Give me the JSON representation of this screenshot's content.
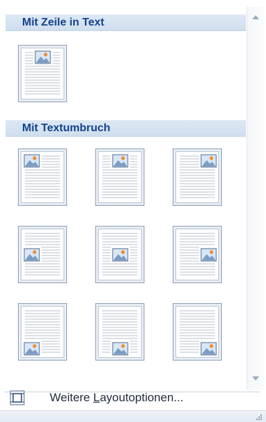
{
  "gallery": {
    "sections": [
      {
        "title": "Mit Zeile in Text"
      },
      {
        "title": "Mit Textumbruch"
      }
    ],
    "inline_options": [
      {
        "name": "inline",
        "image_position": "top-center"
      }
    ],
    "wrap_options": [
      {
        "name": "top-left",
        "image_position": "top-left"
      },
      {
        "name": "top-center",
        "image_position": "top-center"
      },
      {
        "name": "top-right",
        "image_position": "top-right"
      },
      {
        "name": "middle-left",
        "image_position": "middle-left"
      },
      {
        "name": "middle-center",
        "image_position": "middle-center"
      },
      {
        "name": "middle-right",
        "image_position": "middle-right"
      },
      {
        "name": "bottom-left",
        "image_position": "bottom-left"
      },
      {
        "name": "bottom-center",
        "image_position": "bottom-center"
      },
      {
        "name": "bottom-right",
        "image_position": "bottom-right"
      }
    ]
  },
  "more_options": {
    "label_before": "Weitere ",
    "label_accel": "L",
    "label_after": "ayoutoptionen...",
    "icon": "layout-frame-icon"
  },
  "colors": {
    "header_text": "#15428b",
    "header_bg": "#d6e3f1",
    "page_border": "#8b9cb3"
  }
}
